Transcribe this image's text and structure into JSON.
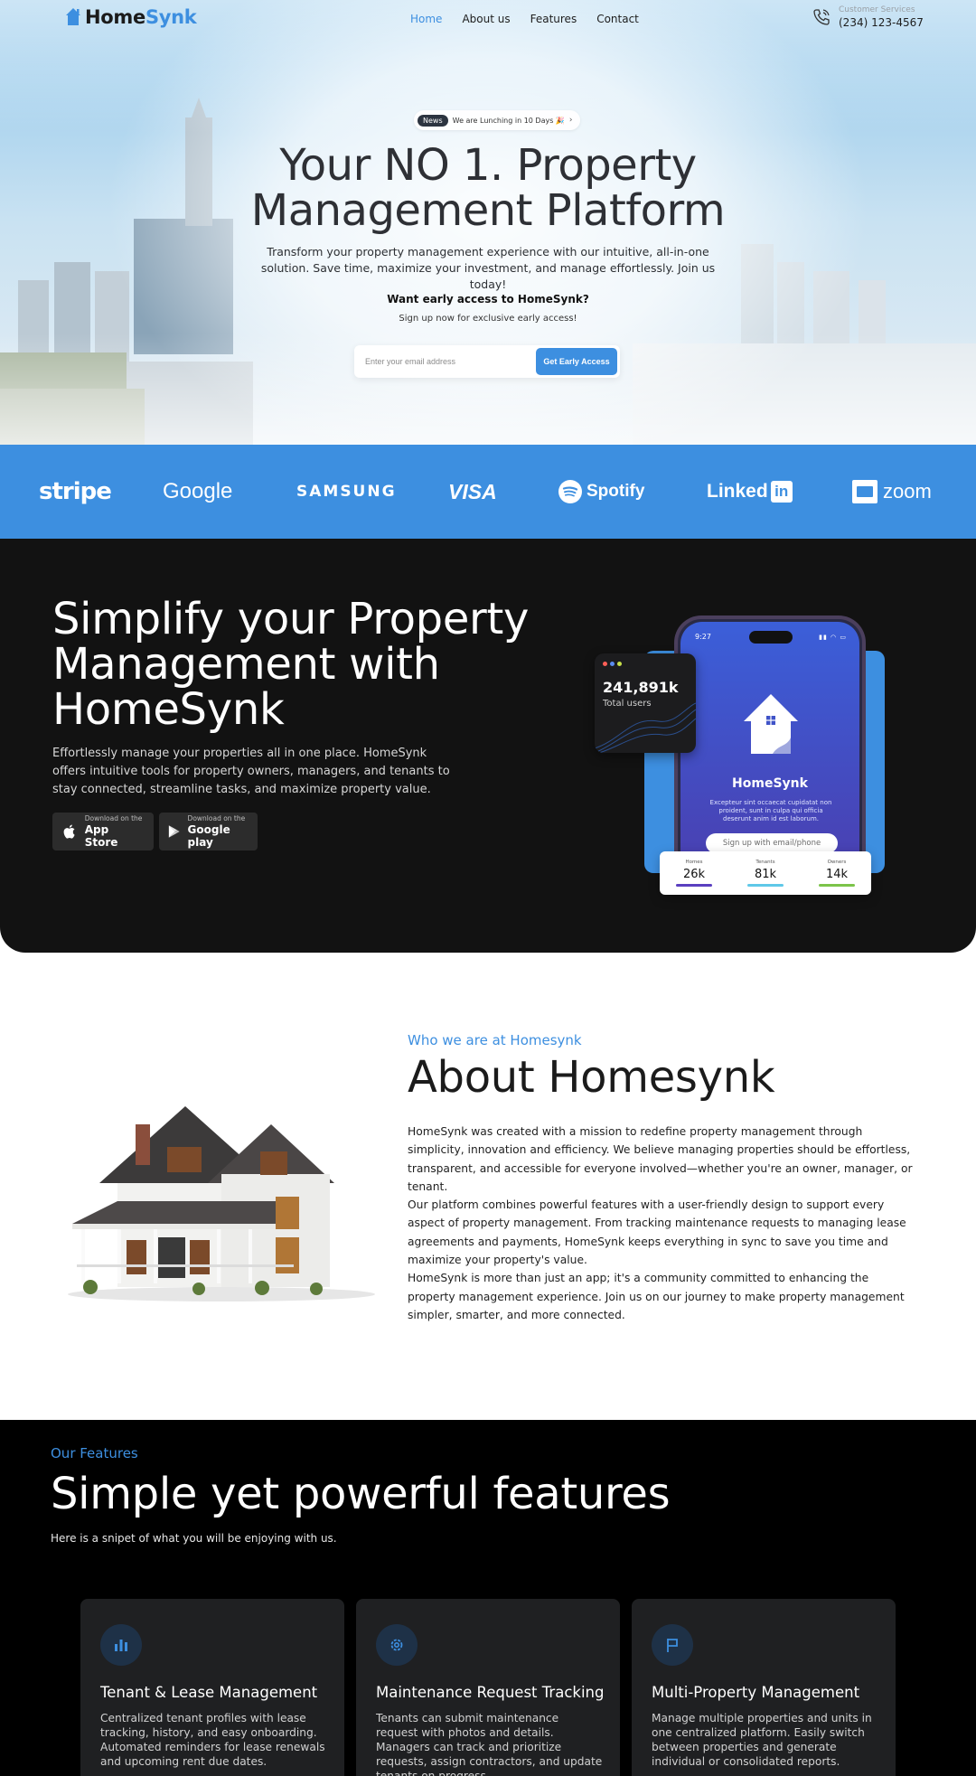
{
  "nav": {
    "logo_part1": "Home",
    "logo_part2": "Synk",
    "links": [
      "Home",
      "About us",
      "Features",
      "Contact"
    ],
    "customer_service_label": "Customer Services",
    "customer_service_phone": "(234) 123-4567"
  },
  "hero": {
    "news_badge": "News",
    "news_text": "We are Lunching in 10 Days 🎉",
    "news_arrow": "›",
    "title_line1": "Your NO 1. Property",
    "title_line2": "Management Platform",
    "subtitle": "Transform your property management experience with our intuitive, all-in-one solution. Save time, maximize your investment, and manage effortlessly. Join us today!",
    "cta_question": "Want early access to HomeSynk?",
    "cta_sub": "Sign up now for exclusive early access!",
    "email_placeholder": "Enter your email address",
    "cta_button": "Get Early Access"
  },
  "brands": {
    "stripe": "stripe",
    "google": "Google",
    "samsung": "SAMSUNG",
    "visa": "VISA",
    "spotify": "Spotify",
    "linkedin": "Linked",
    "linkedin_box": "in",
    "zoom": "zoom"
  },
  "simplify": {
    "title_line1": "Simplify your Property",
    "title_line2": "Management with",
    "title_line3": "HomeSynk",
    "subtitle": "Effortlessly manage your properties all in one place. HomeSynk offers intuitive tools for property owners, managers, and tenants to stay connected, streamline tasks, and maximize property value.",
    "app_store_small": "Download on the",
    "app_store_big": "App Store",
    "google_play_small": "Download on the",
    "google_play_big": "Google play",
    "phone": {
      "time": "9:27",
      "app_name": "HomeSynk",
      "lorem": "Excepteur sint occaecat cupidatat non proident, sunt in culpa qui officia deserunt anim id est laborum.",
      "signup_button": "Sign up with email/phone"
    },
    "users_card": {
      "value": "241,891k",
      "label": "Total users"
    },
    "stats": [
      {
        "label": "Homes",
        "value": "26k",
        "color": "#5a3fc0"
      },
      {
        "label": "Tenants",
        "value": "81k",
        "color": "#5fc8e8"
      },
      {
        "label": "Owners",
        "value": "14k",
        "color": "#7cc44a"
      }
    ],
    "colors": {
      "accent": "#3d8fe0",
      "dark_bg": "#121212"
    }
  },
  "about": {
    "kicker": "Who we are at Homesynk",
    "title": "About Homesynk",
    "paragraphs": [
      "HomeSynk was created with a mission to redefine property management through simplicity, innovation and efficiency. We believe managing properties should be effortless, transparent, and accessible for everyone involved—whether you're an owner, manager, or tenant.",
      "Our platform combines powerful features with a user-friendly design to support every aspect of property management. From tracking maintenance requests to managing lease agreements and payments, HomeSynk keeps everything in sync to save you time and maximize your property's value.",
      "HomeSynk is more than just an app; it's a community committed to enhancing the property management experience. Join us on our journey to make property management simpler, smarter, and more connected."
    ]
  },
  "features": {
    "kicker": "Our Features",
    "title": "Simple yet powerful features",
    "subtitle": "Here is a snipet of what you will be enjoying with us.",
    "cards": [
      {
        "icon": "bar-chart-icon",
        "title": "Tenant & Lease Management",
        "description": "Centralized tenant profiles with lease tracking, history, and easy onboarding. Automated reminders for lease renewals and upcoming rent due dates."
      },
      {
        "icon": "gear-icon",
        "title": "Maintenance Request Tracking",
        "description": "Tenants can submit maintenance request with photos and details. Managers can track and prioritize requests, assign contractors, and update tenants on progress."
      },
      {
        "icon": "flag-icon",
        "title": "Multi-Property Management",
        "description": "Manage multiple properties and units in one centralized platform. Easily switch between properties and generate individual or consolidated reports."
      }
    ]
  }
}
